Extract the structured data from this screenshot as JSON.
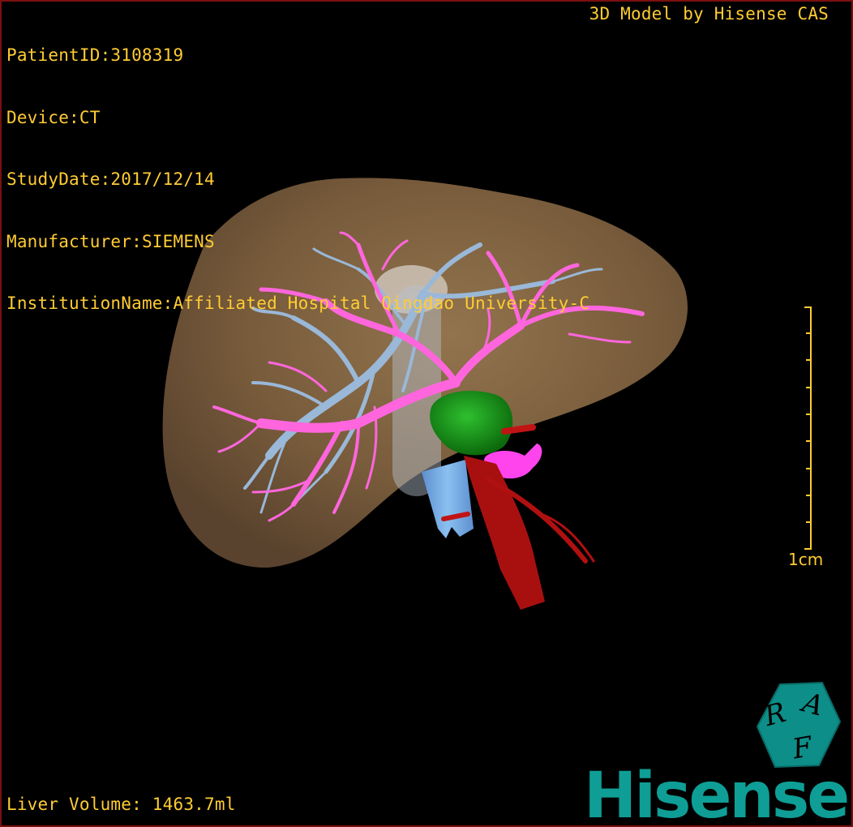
{
  "patient_info": {
    "patient_id": "PatientID:3108319",
    "device": "Device:CT",
    "study_date": "StudyDate:2017/12/14",
    "manufacturer": "Manufacturer:SIEMENS",
    "institution": "InstitutionName:Affiliated Hospital Qingdao University-C"
  },
  "credit": "3D Model by Hisense CAS",
  "scale": {
    "label": "1cm"
  },
  "measurement": {
    "liver_volume": "Liver Volume: 1463.7ml"
  },
  "logos": {
    "raf_letters": [
      "R",
      "A",
      "F"
    ],
    "brand": "Hisense"
  },
  "colors": {
    "overlay_text": "#ffcc33",
    "border": "#7a1010",
    "liver": "#8a6a44",
    "portal_vein": "#ff66dd",
    "hepatic_vein": "#9ab8d8",
    "vena_cava": "#7aaee8",
    "artery": "#b01010",
    "lesion": "#1e9e1e",
    "brand": "#0e9e96"
  },
  "icons": {
    "scale_bar": "scale-ruler-icon",
    "raf": "raf-hexagon-icon"
  }
}
